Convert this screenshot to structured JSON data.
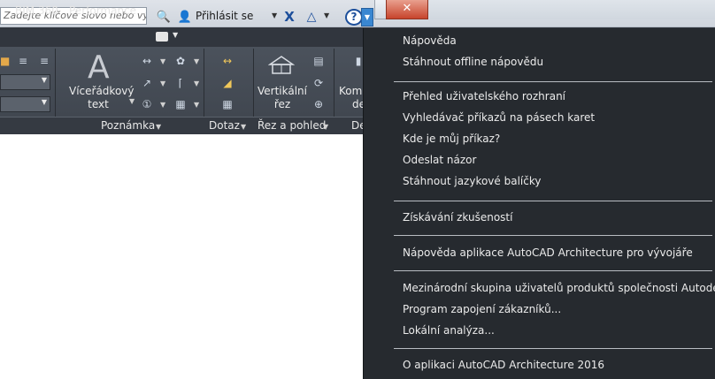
{
  "search": {
    "placeholder": "Zadejte klíčové slovo nebo výraz."
  },
  "header": {
    "sign_in": "Přihlásit se"
  },
  "tabs": [
    {
      "label": "BIM 360"
    },
    {
      "label": "Performance"
    }
  ],
  "ribbon": {
    "multiline_text": {
      "line1": "Víceřádkový",
      "line2": "text"
    },
    "vertical_section": {
      "line1": "Vertikální",
      "line2": "řez"
    },
    "partial_button": {
      "line1": "Komp",
      "line2": "de"
    },
    "panels": {
      "annotation": "Poznámka",
      "query": "Dotaz",
      "section": "Řez a pohled",
      "partial": "De"
    }
  },
  "menu": {
    "groups": [
      {
        "items": [
          "Nápověda",
          "Stáhnout offline nápovědu"
        ]
      },
      {
        "items": [
          "Přehled uživatelského rozhraní",
          "Vyhledávač příkazů na pásech karet",
          "Kde je můj příkaz?",
          "Odeslat názor",
          "Stáhnout jazykové balíčky"
        ]
      },
      {
        "items": [
          "Získávání zkušeností"
        ]
      },
      {
        "items": [
          "Nápověda aplikace AutoCAD Architecture pro vývojáře"
        ]
      },
      {
        "items": [
          "Mezinárodní skupina uživatelů produktů společnosti Autodesk",
          "Program zapojení zákazníků...",
          "Lokální analýza..."
        ]
      },
      {
        "items": [
          "O aplikaci AutoCAD Architecture 2016"
        ]
      }
    ]
  },
  "colors": {
    "menu_bg": "#262a2f",
    "ribbon_bg": "#434952",
    "accent": "#1d4f9b"
  }
}
